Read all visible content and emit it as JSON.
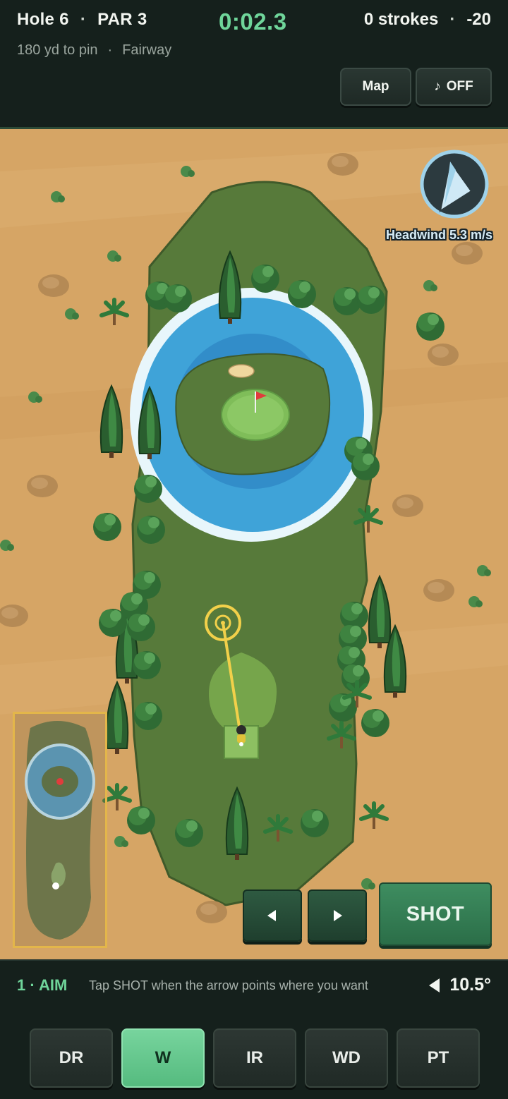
{
  "header": {
    "hole": "Hole 6",
    "par": "PAR 3",
    "timer": "0:02.3",
    "strokes": "0 strokes",
    "score": "-20",
    "distance": "180 yd to pin",
    "lie": "Fairway",
    "map_label": "Map",
    "sound_icon": "music-note-icon",
    "sound_label": "OFF"
  },
  "wind": {
    "label": "Headwind 5.3 m/s",
    "icon": "wind-arrow-icon"
  },
  "controls": {
    "left_icon": "arrow-left-icon",
    "right_icon": "arrow-right-icon",
    "shot_label": "SHOT"
  },
  "status": {
    "step": "1 · AIM",
    "hint": "Tap SHOT when the arrow points where you want",
    "angle": "10.5°"
  },
  "clubs": [
    {
      "label": "DR",
      "active": false
    },
    {
      "label": "W",
      "active": true
    },
    {
      "label": "IR",
      "active": false
    },
    {
      "label": "WD",
      "active": false
    },
    {
      "label": "PT",
      "active": false
    }
  ],
  "colors": {
    "accent": "#6fd59a",
    "sand": "#d7a766",
    "fairway": "#577a3a",
    "water": "#3fa3d8",
    "minimap_border": "#e3b64a"
  }
}
